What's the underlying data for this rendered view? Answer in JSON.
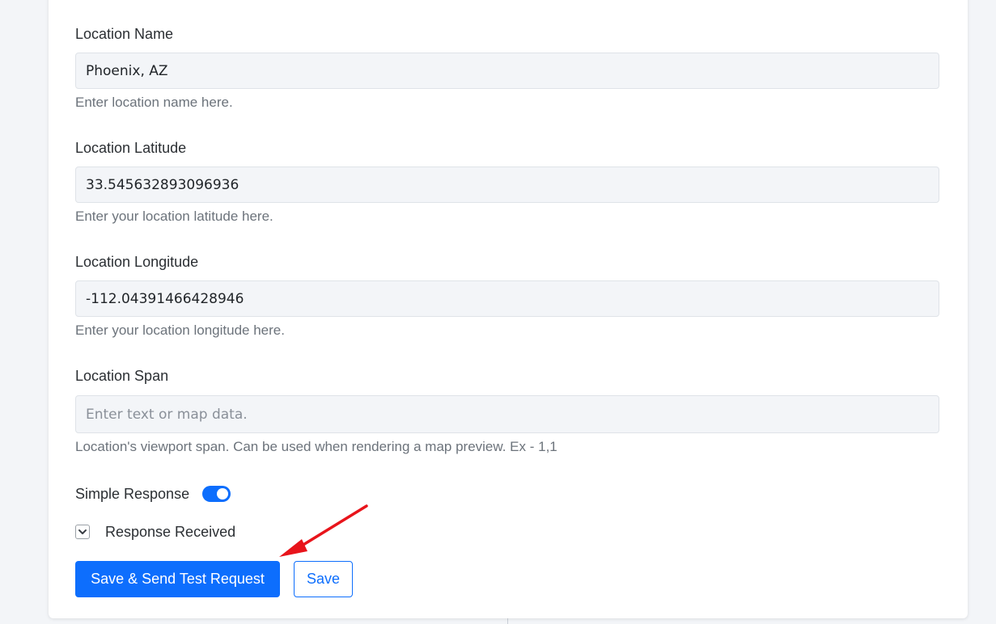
{
  "form": {
    "location_name": {
      "label": "Location Name",
      "value": "Phoenix, AZ",
      "help": "Enter location name here."
    },
    "location_latitude": {
      "label": "Location Latitude",
      "value": "33.545632893096936",
      "help": "Enter your location latitude here."
    },
    "location_longitude": {
      "label": "Location Longitude",
      "value": "-112.04391466428946",
      "help": "Enter your location longitude here."
    },
    "location_span": {
      "label": "Location Span",
      "value": "",
      "placeholder": "Enter text or map data.",
      "help": "Location's viewport span. Can be used when rendering a map preview. Ex - 1,1"
    },
    "simple_response": {
      "label": "Simple Response",
      "enabled": true
    },
    "response_received": {
      "label": "Response Received",
      "icon": "chevron-down-icon"
    },
    "buttons": {
      "save_send": "Save & Send Test Request",
      "save": "Save"
    }
  },
  "colors": {
    "primary": "#0d6efd",
    "annotation": "#e8141b"
  }
}
